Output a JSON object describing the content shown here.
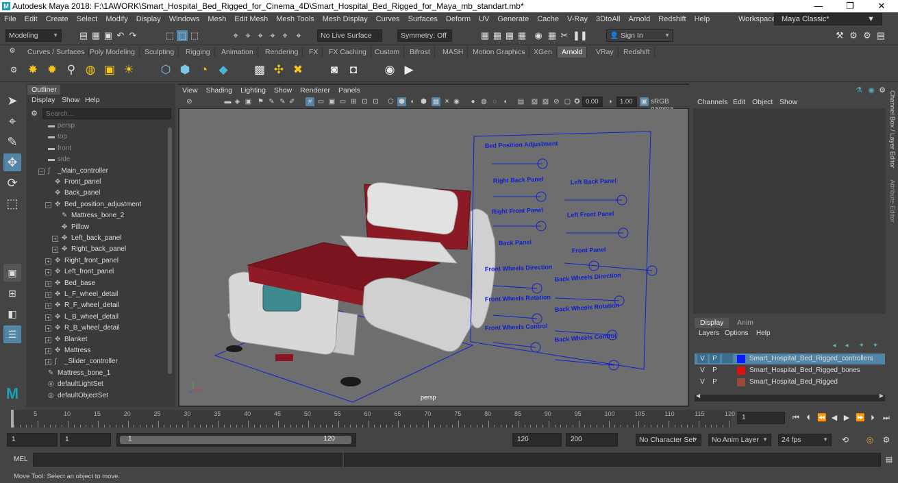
{
  "window": {
    "title": "Autodesk Maya 2018: F:\\1AWORK\\Smart_Hospital_Bed_Rigged_for_Cinema_4D\\Smart_Hospital_Bed_Rigged_for_Maya_mb_standart.mb*",
    "logo_letter": "M",
    "minimize": "—",
    "maximize": "❐",
    "close": "✕"
  },
  "menubar": {
    "items": [
      "File",
      "Edit",
      "Create",
      "Select",
      "Modify",
      "Display",
      "Windows",
      "Mesh",
      "Edit Mesh",
      "Mesh Tools",
      "Mesh Display",
      "Curves",
      "Surfaces",
      "Deform",
      "UV",
      "Generate",
      "Cache",
      "V-Ray",
      "3DtoAll",
      "Arnold",
      "Redshift",
      "Help"
    ],
    "workspace_label": "Workspace :",
    "workspace_value": "Maya Classic*"
  },
  "statusline": {
    "mode": "Modeling",
    "live_surface": "No Live Surface",
    "symmetry": "Symmetry: Off",
    "sign_in": "Sign In"
  },
  "shelf": {
    "tabs": [
      "Curves / Surfaces",
      "Poly Modeling",
      "Sculpting",
      "Rigging",
      "Animation",
      "Rendering",
      "FX",
      "FX Caching",
      "Custom",
      "Bifrost",
      "MASH",
      "Motion Graphics",
      "XGen",
      "Arnold",
      "VRay",
      "Redshift"
    ],
    "active_tab": "Arnold"
  },
  "outliner": {
    "tab": "Outliner",
    "menu": [
      "Display",
      "Show",
      "Help"
    ],
    "search_placeholder": "Search...",
    "items": [
      {
        "label": "persp",
        "indent": 0,
        "icon": "camera",
        "dim": true,
        "expander": ""
      },
      {
        "label": "top",
        "indent": 0,
        "icon": "camera",
        "dim": true,
        "expander": ""
      },
      {
        "label": "front",
        "indent": 0,
        "icon": "camera",
        "dim": true,
        "expander": ""
      },
      {
        "label": "side",
        "indent": 0,
        "icon": "camera",
        "dim": true,
        "expander": ""
      },
      {
        "label": "_Main_controller",
        "indent": 0,
        "icon": "curve",
        "dim": false,
        "expander": "−"
      },
      {
        "label": "Front_panel",
        "indent": 1,
        "icon": "joint",
        "dim": false,
        "expander": ""
      },
      {
        "label": "Back_panel",
        "indent": 1,
        "icon": "joint",
        "dim": false,
        "expander": ""
      },
      {
        "label": "Bed_position_adjustment",
        "indent": 1,
        "icon": "joint",
        "dim": false,
        "expander": "−"
      },
      {
        "label": "Mattress_bone_2",
        "indent": 2,
        "icon": "bone",
        "dim": false,
        "expander": ""
      },
      {
        "label": "Pillow",
        "indent": 2,
        "icon": "joint",
        "dim": false,
        "expander": ""
      },
      {
        "label": "Left_back_panel",
        "indent": 2,
        "icon": "joint",
        "dim": false,
        "expander": "+"
      },
      {
        "label": "Right_back_panel",
        "indent": 2,
        "icon": "joint",
        "dim": false,
        "expander": "+"
      },
      {
        "label": "Right_front_panel",
        "indent": 1,
        "icon": "joint",
        "dim": false,
        "expander": "+"
      },
      {
        "label": "Left_front_panel",
        "indent": 1,
        "icon": "joint",
        "dim": false,
        "expander": "+"
      },
      {
        "label": "Bed_base",
        "indent": 1,
        "icon": "joint",
        "dim": false,
        "expander": "+"
      },
      {
        "label": "L_F_wheel_detail",
        "indent": 1,
        "icon": "joint",
        "dim": false,
        "expander": "+"
      },
      {
        "label": "R_F_wheel_detail",
        "indent": 1,
        "icon": "joint",
        "dim": false,
        "expander": "+"
      },
      {
        "label": "L_B_wheel_detail",
        "indent": 1,
        "icon": "joint",
        "dim": false,
        "expander": "+"
      },
      {
        "label": "R_B_wheel_detail",
        "indent": 1,
        "icon": "joint",
        "dim": false,
        "expander": "+"
      },
      {
        "label": "Blanket",
        "indent": 1,
        "icon": "joint",
        "dim": false,
        "expander": "+"
      },
      {
        "label": "Mattress",
        "indent": 1,
        "icon": "joint",
        "dim": false,
        "expander": "+"
      },
      {
        "label": "_Slider_controller",
        "indent": 1,
        "icon": "curve",
        "dim": false,
        "expander": "+"
      },
      {
        "label": "Mattress_bone_1",
        "indent": 0,
        "icon": "bone",
        "dim": false,
        "expander": ""
      },
      {
        "label": "defaultLightSet",
        "indent": 0,
        "icon": "set",
        "dim": false,
        "expander": ""
      },
      {
        "label": "defaultObjectSet",
        "indent": 0,
        "icon": "set",
        "dim": false,
        "expander": ""
      }
    ]
  },
  "viewport": {
    "menu": [
      "View",
      "Shading",
      "Lighting",
      "Show",
      "Renderer",
      "Panels"
    ],
    "exposure": "0.00",
    "gamma": "1.00",
    "color_space": "sRGB gamma",
    "camera_label": "persp",
    "controller_labels": [
      "Bed Position Adjustment",
      "Right Back Panel",
      "Left Back Panel",
      "Right Front Panel",
      "Left Front Panel",
      "Back Panel",
      "Front Panel",
      "Front Wheels Direction",
      "Back Wheels Direction",
      "Front Wheels Rotation",
      "Back Wheels Rotation",
      "Front Wheels Control",
      "Back Wheels Control"
    ]
  },
  "channelbox": {
    "menu": [
      "Channels",
      "Edit",
      "Object",
      "Show"
    ],
    "side_tabs": [
      "Channel Box / Layer Editor",
      "Attribute Editor"
    ]
  },
  "layers": {
    "tabs": [
      "Display",
      "Anim"
    ],
    "active_tab": "Display",
    "menu": [
      "Layers",
      "Options",
      "Help"
    ],
    "rows": [
      {
        "v": "V",
        "p": "P",
        "name": "Smart_Hospital_Bed_Rigged_controllers",
        "color": "#0a1aff",
        "selected": true
      },
      {
        "v": "V",
        "p": "P",
        "name": "Smart_Hospital_Bed_Rigged_bones",
        "color": "#e01010",
        "selected": false
      },
      {
        "v": "V",
        "p": "P",
        "name": "Smart_Hospital_Bed_Rigged",
        "color": "#9a4a3a",
        "selected": false
      }
    ]
  },
  "timeline": {
    "ticks": [
      "5",
      "10",
      "15",
      "20",
      "25",
      "30",
      "35",
      "40",
      "45",
      "50",
      "55",
      "60",
      "65",
      "70",
      "75",
      "80",
      "85",
      "90",
      "95",
      "100",
      "105",
      "110",
      "115",
      "120"
    ],
    "current_frame": "1"
  },
  "range": {
    "start": "1",
    "playback_start": "1",
    "slider_start": "1",
    "slider_end": "120",
    "playback_end": "120",
    "end": "200",
    "character_set": "No Character Set",
    "anim_layer": "No Anim Layer",
    "fps": "24 fps"
  },
  "cmdline": {
    "label": "MEL"
  },
  "helpline": {
    "text": "Move Tool: Select an object to move."
  }
}
